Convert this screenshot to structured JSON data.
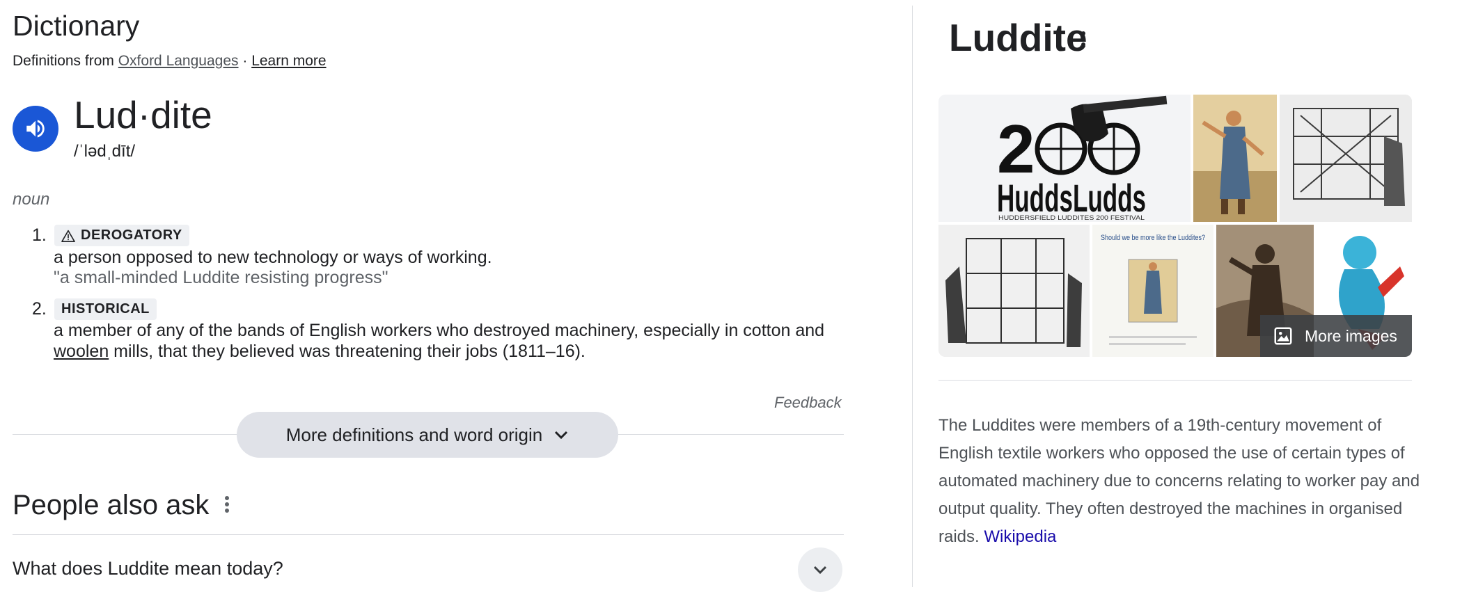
{
  "dictionary": {
    "title": "Dictionary",
    "source_prefix": "Definitions from ",
    "source_name": "Oxford Languages",
    "separator": " · ",
    "learn_more": "Learn more",
    "headword": "Lud·dite",
    "phonetic": "/ˈlədˌdīt/",
    "part_of_speech": "noun",
    "senses": [
      {
        "number": "1.",
        "label": "DEROGATORY",
        "definition": "a person opposed to new technology or ways of working.",
        "example": "\"a small-minded Luddite resisting progress\""
      },
      {
        "number": "2.",
        "label": "HISTORICAL",
        "definition_line1": "a member of any of the bands of English workers who destroyed machinery, especially in cotton and",
        "definition_link": "woolen",
        "definition_line2_rest": " mills, that they believed was threatening their jobs (1811–16)."
      }
    ],
    "feedback": "Feedback",
    "more_button": "More definitions and word origin"
  },
  "people_also_ask": {
    "title": "People also ask",
    "questions": [
      "What does Luddite mean today?"
    ]
  },
  "knowledge_panel": {
    "title": "Luddite",
    "image_text": {
      "logo_number": "2",
      "logo_word": "HuddsLudds",
      "logo_caption": "HUDDERSFIELD LUDDITES 200 FESTIVAL",
      "poster_caption": "Should we be more like the Luddites?"
    },
    "more_images": "More images",
    "description": "The Luddites were members of a 19th-century movement of English textile workers who opposed the use of certain types of automated machinery due to concerns relating to worker pay and output quality. They often destroyed the machines in organised raids.",
    "source_link": "Wikipedia"
  },
  "colors": {
    "speaker_bg": "#1a57d6",
    "link": "#1a0dab",
    "button_bg": "#e0e2e8"
  },
  "icons": [
    "speaker-icon",
    "warning-icon",
    "chevron-down-icon",
    "more-vert-icon",
    "image-icon"
  ]
}
